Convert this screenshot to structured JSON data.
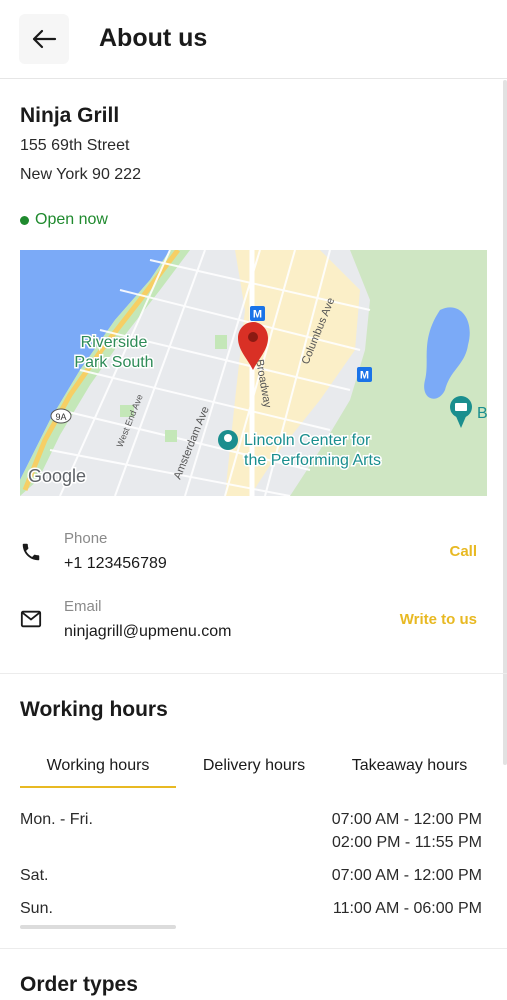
{
  "header": {
    "title": "About us"
  },
  "restaurant": {
    "name": "Ninja Grill",
    "address_line1": "155 69th Street",
    "address_line2": "New York 90 222",
    "status": "Open now"
  },
  "map": {
    "labels": {
      "riverside_1": "Riverside",
      "riverside_2": "Park South",
      "lincoln_1": "Lincoln Center for",
      "lincoln_2": "the Performing Arts",
      "columbus": "Columbus Ave",
      "broadway": "Broadway",
      "amsterdam": "Amsterdam Ave",
      "west_end": "West End Ave",
      "route": "9A",
      "metro": "M",
      "poi_b": "B",
      "google": "Google"
    }
  },
  "contact": {
    "phone_label": "Phone",
    "phone_value": "+1 123456789",
    "phone_action": "Call",
    "email_label": "Email",
    "email_value": "ninjagrill@upmenu.com",
    "email_action": "Write to us"
  },
  "working_hours": {
    "title": "Working hours",
    "tabs": [
      "Working hours",
      "Delivery hours",
      "Takeaway hours"
    ],
    "active_tab": 0,
    "rows": [
      {
        "day": "Mon. - Fri.",
        "times": [
          "07:00 AM - 12:00 PM",
          "02:00 PM - 11:55 PM"
        ]
      },
      {
        "day": "Sat.",
        "times": [
          "07:00 AM - 12:00 PM"
        ]
      },
      {
        "day": "Sun.",
        "times": [
          "11:00 AM - 06:00 PM"
        ]
      }
    ]
  },
  "order_types": {
    "title": "Order types"
  },
  "colors": {
    "accent": "#e8b923",
    "open": "#1f8a2e",
    "pin": "#d93025"
  }
}
